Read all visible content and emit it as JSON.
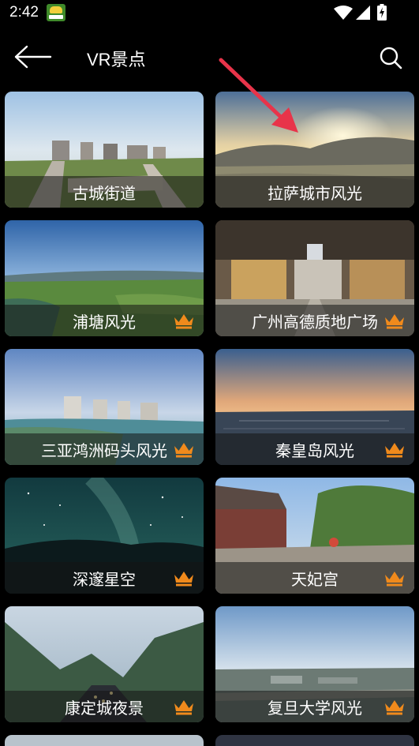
{
  "status_bar": {
    "time": "2:42"
  },
  "header": {
    "title": "VR景点"
  },
  "icons": {
    "back": "back-arrow-icon",
    "search": "search-icon",
    "premium": "crown-icon",
    "app": "app-notification-icon",
    "wifi": "wifi-icon",
    "signal": "signal-icon",
    "battery": "battery-charging-icon"
  },
  "colors": {
    "background": "#000000",
    "crown": "#f08a1c",
    "arrow": "#e8344a"
  },
  "spots": [
    {
      "label": "古城街道",
      "premium": false
    },
    {
      "label": "拉萨城市风光",
      "premium": false
    },
    {
      "label": "浦塘风光",
      "premium": true
    },
    {
      "label": "广州高德质地广场",
      "premium": true
    },
    {
      "label": "三亚鸿洲码头风光",
      "premium": true
    },
    {
      "label": "秦皇岛风光",
      "premium": true
    },
    {
      "label": "深邃星空",
      "premium": true
    },
    {
      "label": "天妃宫",
      "premium": true
    },
    {
      "label": "康定城夜景",
      "premium": true
    },
    {
      "label": "复旦大学风光",
      "premium": true
    }
  ]
}
